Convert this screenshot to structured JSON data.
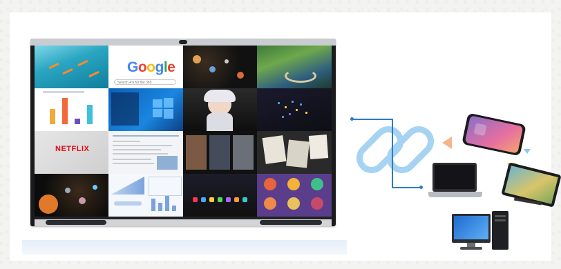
{
  "tiles": {
    "google_logo": "Google",
    "google_search": "Search 4:6 for the 365",
    "netflix_logo": "NETFLIX"
  },
  "colors": {
    "link_chain": "#a6d3f1",
    "connector": "#2d7cc4",
    "arrow_orange": "#f5b48a",
    "arrow_yellow": "#f2d24a",
    "arrow_blue": "#8cc8ef"
  },
  "devices": [
    "phone-icon",
    "laptop-icon",
    "drawing-tablet-icon",
    "desktop-computer-icon"
  ]
}
